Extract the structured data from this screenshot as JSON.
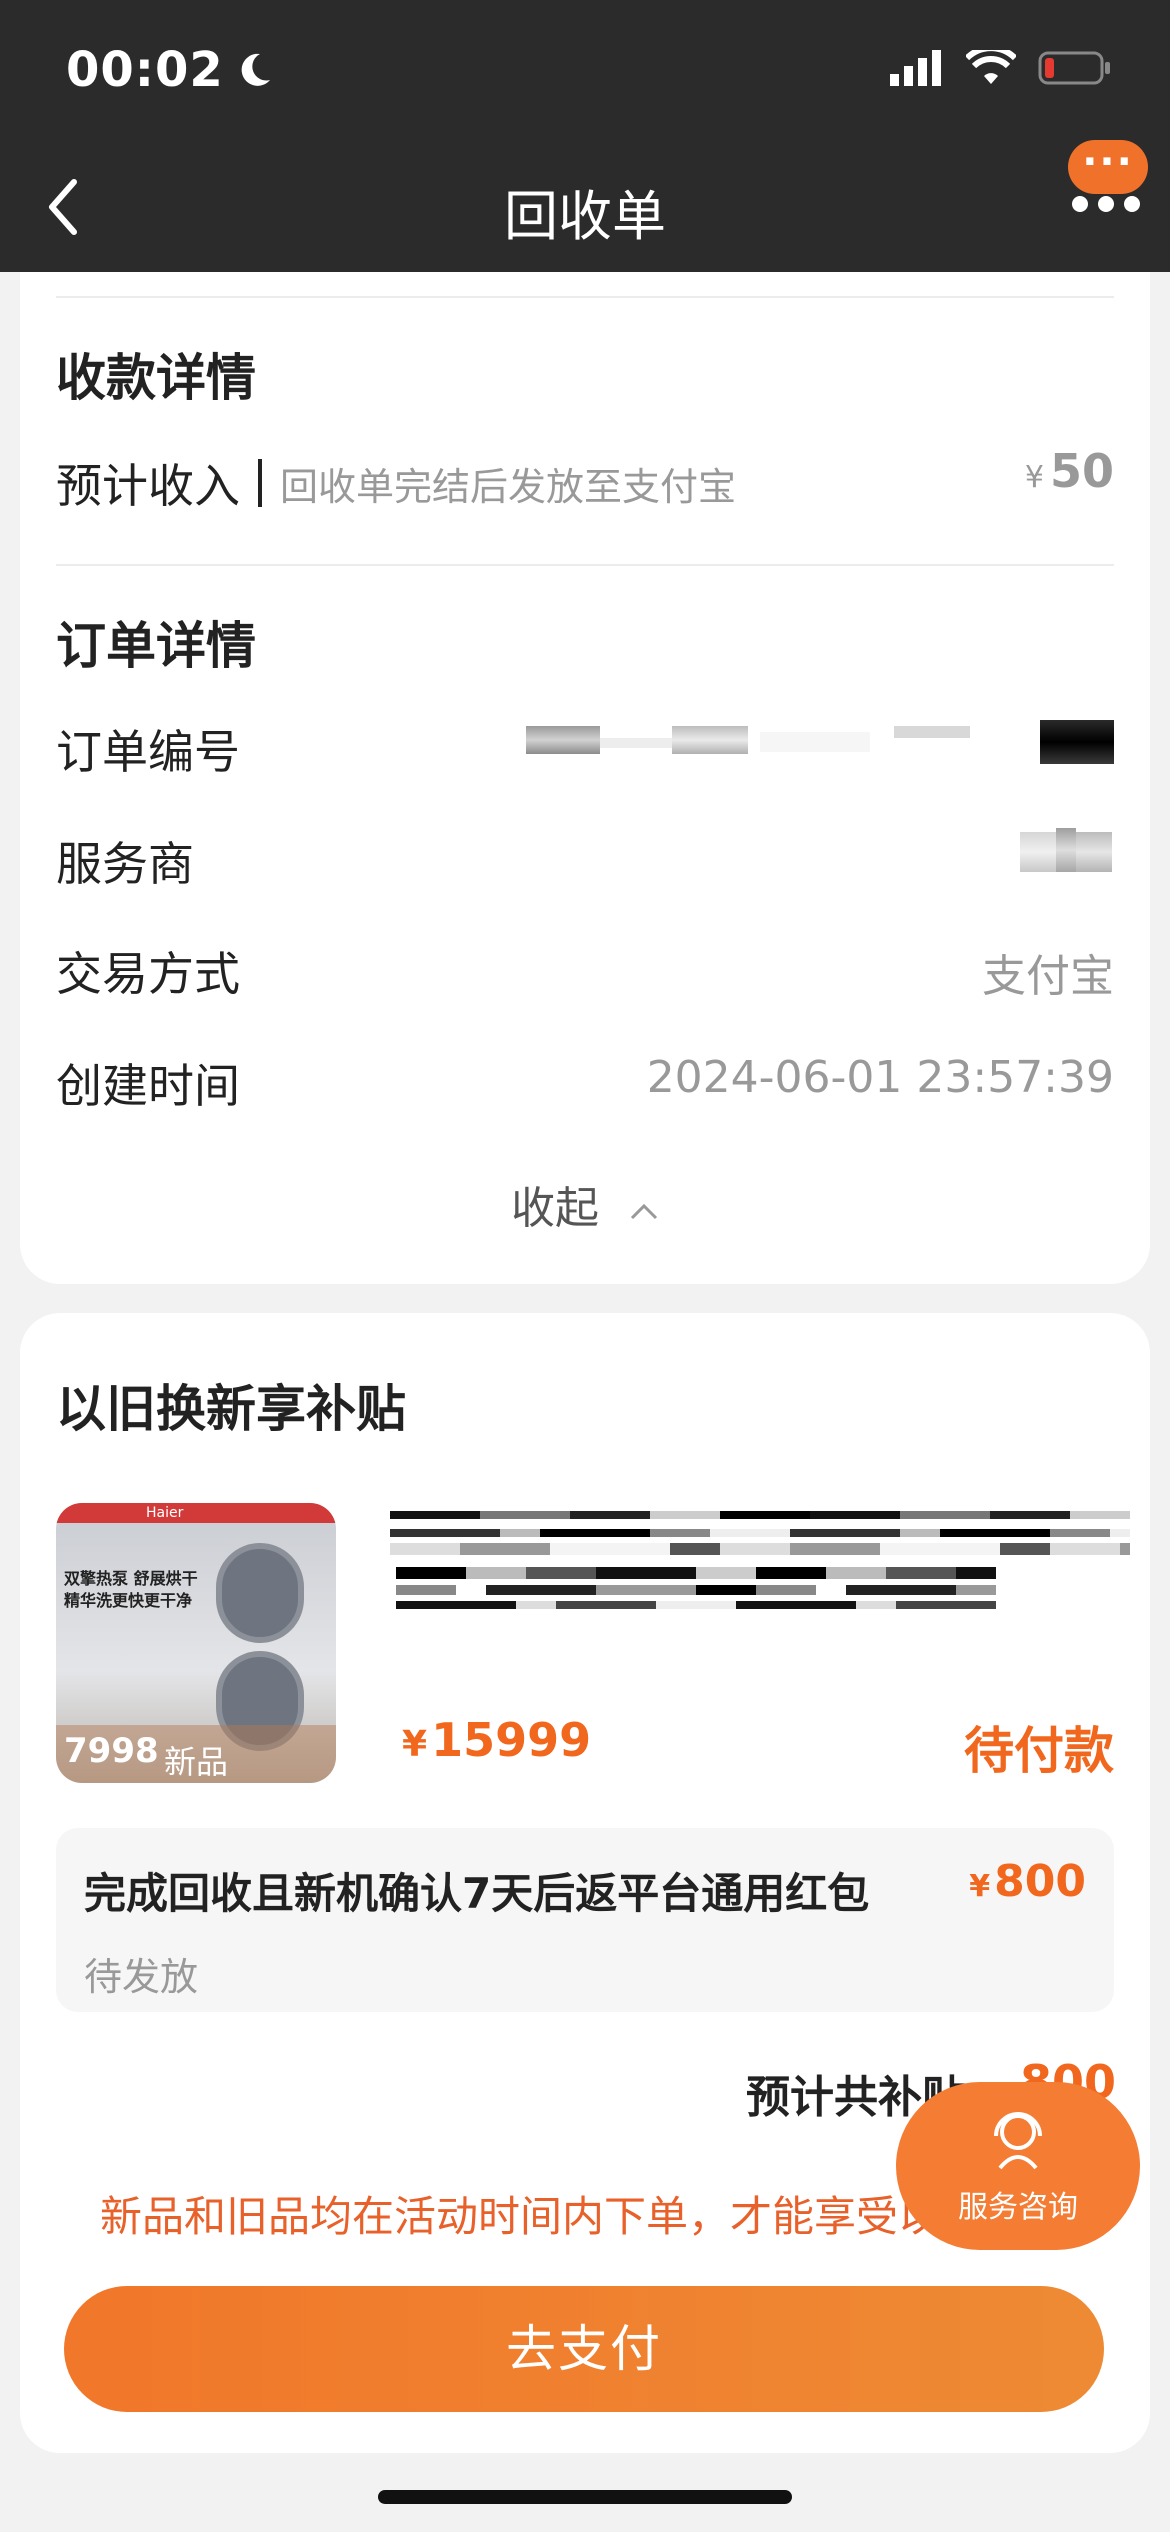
{
  "status_bar": {
    "time": "00:02"
  },
  "nav": {
    "title": "回收单",
    "pill_text": "···"
  },
  "payment": {
    "section_title": "收款详情",
    "label": "预计收入",
    "hint": "回收单完结后发放至支付宝",
    "currency": "¥",
    "amount": "50"
  },
  "order": {
    "section_title": "订单详情",
    "rows": [
      {
        "label": "订单编号",
        "value": ""
      },
      {
        "label": "服务商",
        "value": ""
      },
      {
        "label": "交易方式",
        "value": "支付宝"
      },
      {
        "label": "创建时间",
        "value": "2024-06-01 23:57:39"
      }
    ],
    "collapse_label": "收起"
  },
  "subsidy": {
    "section_title": "以旧换新享补贴",
    "product": {
      "image_brand": "Haier",
      "image_tag1": "双擎热泵 舒展烘干",
      "image_tag2": "精华洗更快更干净",
      "image_price": "7998",
      "image_new": "新品",
      "currency": "¥",
      "price": "15999",
      "status": "待付款"
    },
    "redpack": {
      "title": "完成回收且新机确认7天后返平台通用红包",
      "currency": "¥",
      "amount": "800",
      "status": "待发放"
    },
    "total_label": "预计共补贴",
    "total_value": "800",
    "notice": "新品和旧品均在活动时间内下单，才能享受以旧换新补贴"
  },
  "actions": {
    "pay_button": "去支付",
    "service_label": "服务咨询"
  },
  "colors": {
    "accent": "#f0671d",
    "topbar": "#2b2b2b",
    "button": "#f1772a"
  },
  "icons": [
    "back-chevron-icon",
    "moon-icon",
    "signal-icon",
    "wifi-icon",
    "battery-icon",
    "more-dots-icon",
    "chevron-up-icon",
    "customer-service-icon"
  ]
}
